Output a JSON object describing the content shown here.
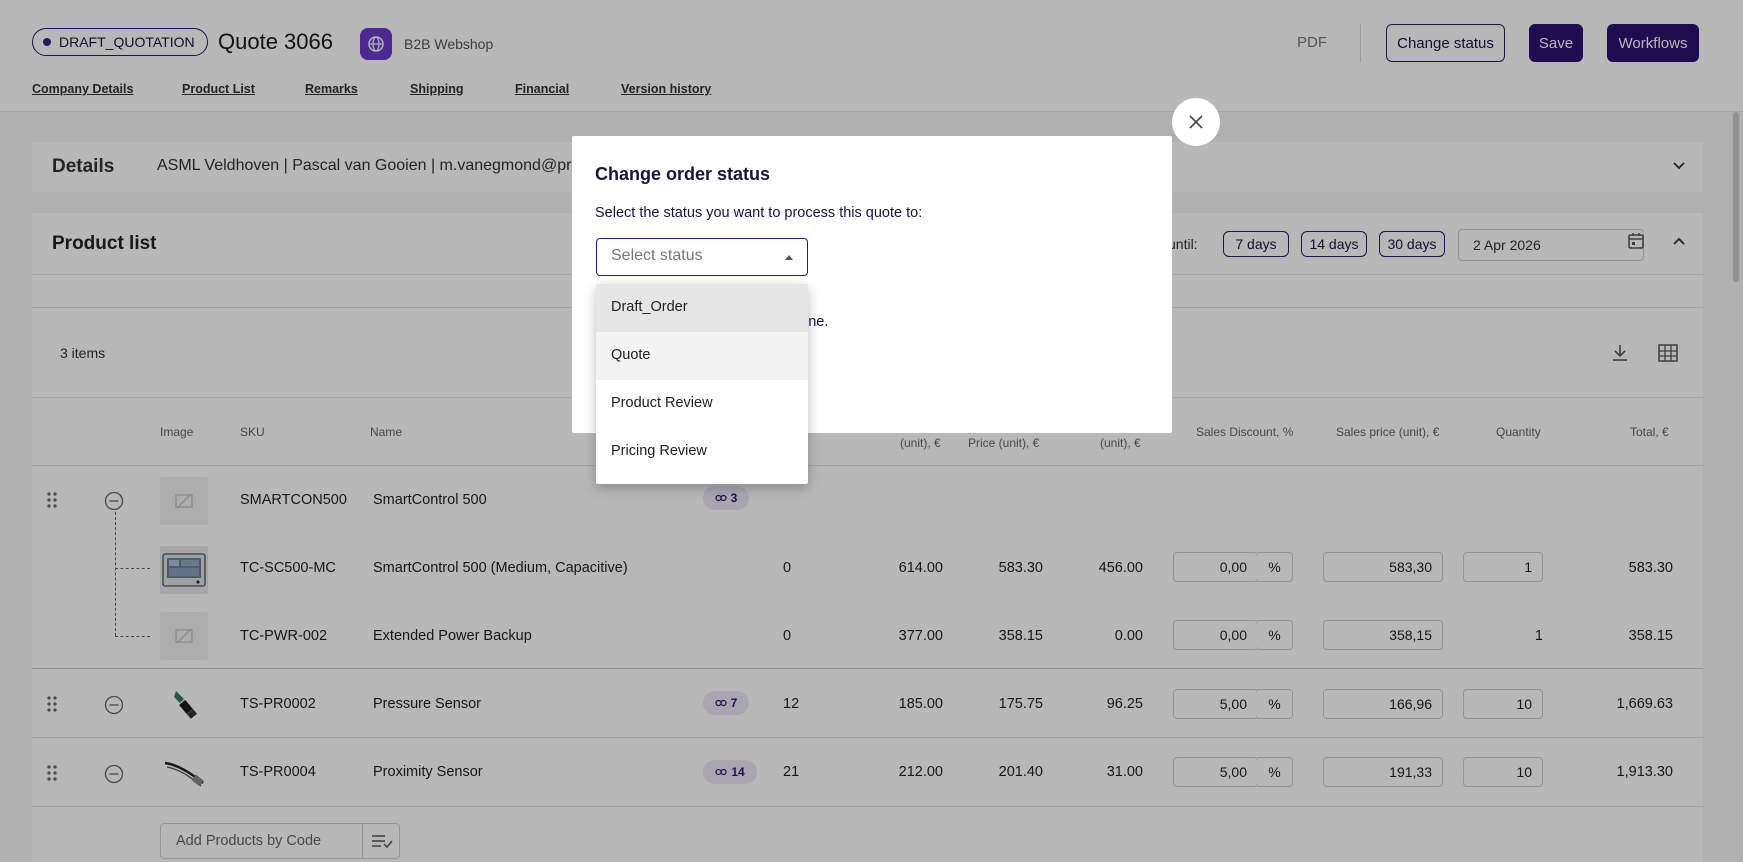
{
  "header": {
    "status": "DRAFT_QUOTATION",
    "title": "Quote 3066",
    "shop": "B2B Webshop",
    "pdf": "PDF",
    "change_status": "Change status",
    "save": "Save",
    "workflows": "Workflows",
    "tabs": [
      "Company Details",
      "Product List",
      "Remarks",
      "Shipping",
      "Financial",
      "Version history"
    ]
  },
  "details": {
    "label": "Details",
    "text": "ASML Veldhoven | Pascal van Gooien | m.vanegmond@prope"
  },
  "product_list": {
    "title": "Product list",
    "until_label": "until:",
    "day_buttons": [
      "7 days",
      "14 days",
      "30 days"
    ],
    "date": "2 Apr 2026",
    "items_count": "3 items",
    "columns": {
      "image": "Image",
      "sku": "SKU",
      "name": "Name",
      "unit1": "(unit), €",
      "price_unit": "Price (unit), €",
      "unit2": "(unit), €",
      "sales_discount": "Sales Discount, %",
      "sales_price": "Sales price (unit), €",
      "quantity": "Quantity",
      "total": "Total, €"
    },
    "rows": [
      {
        "sku": "SMARTCON500",
        "name": "SmartControl 500",
        "badge": "3"
      },
      {
        "sku": "TC-SC500-MC",
        "name": "SmartControl 500 (Medium, Capacitive)",
        "stock": "0",
        "list": "614.00",
        "price": "583.30",
        "cost": "456.00",
        "discount": "0,00",
        "pct": "%",
        "sales_price": "583,30",
        "qty": "1",
        "total": "583.30"
      },
      {
        "sku": "TC-PWR-002",
        "name": "Extended Power Backup",
        "stock": "0",
        "list": "377.00",
        "price": "358.15",
        "cost": "0.00",
        "discount": "0,00",
        "pct": "%",
        "sales_price": "358,15",
        "qty": "1",
        "total": "358.15"
      },
      {
        "sku": "TS-PR0002",
        "name": "Pressure Sensor",
        "badge": "7",
        "stock": "12",
        "list": "185.00",
        "price": "175.75",
        "cost": "96.25",
        "discount": "5,00",
        "pct": "%",
        "sales_price": "166,96",
        "qty": "10",
        "total": "1,669.63"
      },
      {
        "sku": "TS-PR0004",
        "name": "Proximity Sensor",
        "badge": "14",
        "stock": "21",
        "list": "212.00",
        "price": "201.40",
        "cost": "31.00",
        "discount": "5,00",
        "pct": "%",
        "sales_price": "191,33",
        "qty": "10",
        "total": "1,913.30"
      }
    ],
    "add_products_placeholder": "Add Products by Code"
  },
  "modal": {
    "title": "Change order status",
    "subtitle": "Select the status you want to process this quote to:",
    "select_placeholder": "Select status",
    "hint": "ndone.",
    "options": [
      "Draft_Order",
      "Quote",
      "Product Review",
      "Pricing Review"
    ]
  },
  "colors": {
    "brand_dark": "#2b1070",
    "accent": "#6a3ac7",
    "overlay": "rgba(0,0,0,0.28)"
  }
}
